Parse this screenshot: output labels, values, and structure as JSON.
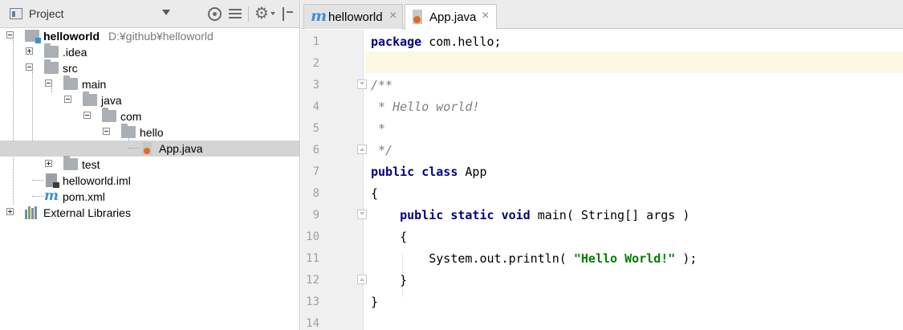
{
  "project_panel": {
    "title": "Project",
    "tree": [
      {
        "label": "helloworld",
        "path": "D:¥github¥helloworld"
      },
      {
        "label": ".idea"
      },
      {
        "label": "src"
      },
      {
        "label": "main"
      },
      {
        "label": "java"
      },
      {
        "label": "com"
      },
      {
        "label": "hello"
      },
      {
        "label": "App.java"
      },
      {
        "label": "test"
      },
      {
        "label": "helloworld.iml"
      },
      {
        "label": "pom.xml"
      },
      {
        "label": "External Libraries"
      }
    ]
  },
  "editor": {
    "tabs": [
      {
        "label": "helloworld",
        "close": "×",
        "icon": "maven-icon"
      },
      {
        "label": "App.java",
        "close": "×",
        "icon": "java-class-icon"
      }
    ],
    "line_numbers": [
      "1",
      "2",
      "3",
      "4",
      "5",
      "6",
      "7",
      "8",
      "9",
      "10",
      "11",
      "12",
      "13",
      "14"
    ],
    "code": {
      "l1_kw": "package",
      "l1_rest": " com.hello;",
      "l3": "/**",
      "l4": " * Hello world!",
      "l5": " *",
      "l6": " */",
      "l7_kw1": "public",
      "l7_sp": " ",
      "l7_kw2": "class",
      "l7_rest": " App",
      "l8": "{",
      "l9_indent": "    ",
      "l9_kw1": "public",
      "l9_kw2": "static",
      "l9_kw3": "void",
      "l9_rest": " main( String[] args )",
      "l10": "    {",
      "l11_pre": "        System.out.println( ",
      "l11_str": "\"Hello World!\"",
      "l11_post": " );",
      "l12": "    }",
      "l13": "}"
    }
  },
  "colors": {
    "keyword": "#000080",
    "comment": "#808080",
    "string": "#008000",
    "caret_line": "#fdf8e3",
    "selection": "#d4d4d4"
  }
}
